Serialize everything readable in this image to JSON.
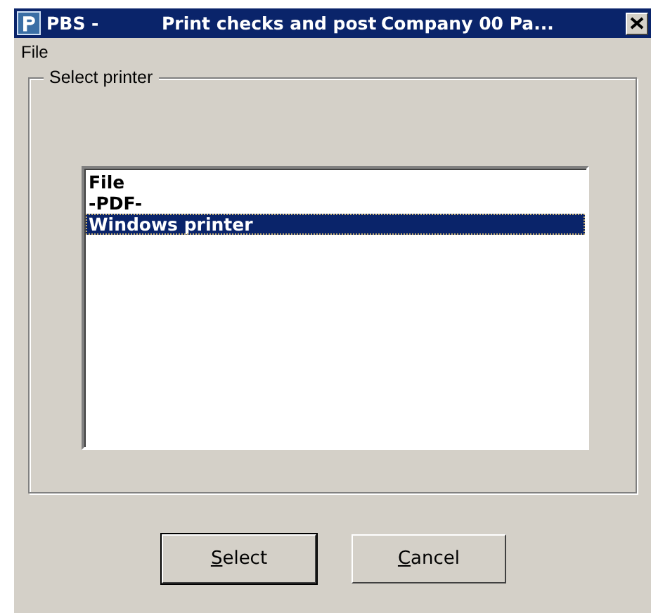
{
  "window": {
    "title_parts": [
      "PBS -",
      "Print checks and post",
      "Company 00  Pa..."
    ]
  },
  "menu": [
    "File"
  ],
  "group": {
    "label": "Select printer"
  },
  "printers": [
    {
      "label": "File",
      "selected": false
    },
    {
      "label": "-PDF-",
      "selected": false
    },
    {
      "label": "Windows printer",
      "selected": true
    }
  ],
  "buttons": [
    {
      "accel": "S",
      "rest": "elect",
      "default": true
    },
    {
      "accel": "C",
      "rest": "ancel",
      "default": false
    }
  ]
}
